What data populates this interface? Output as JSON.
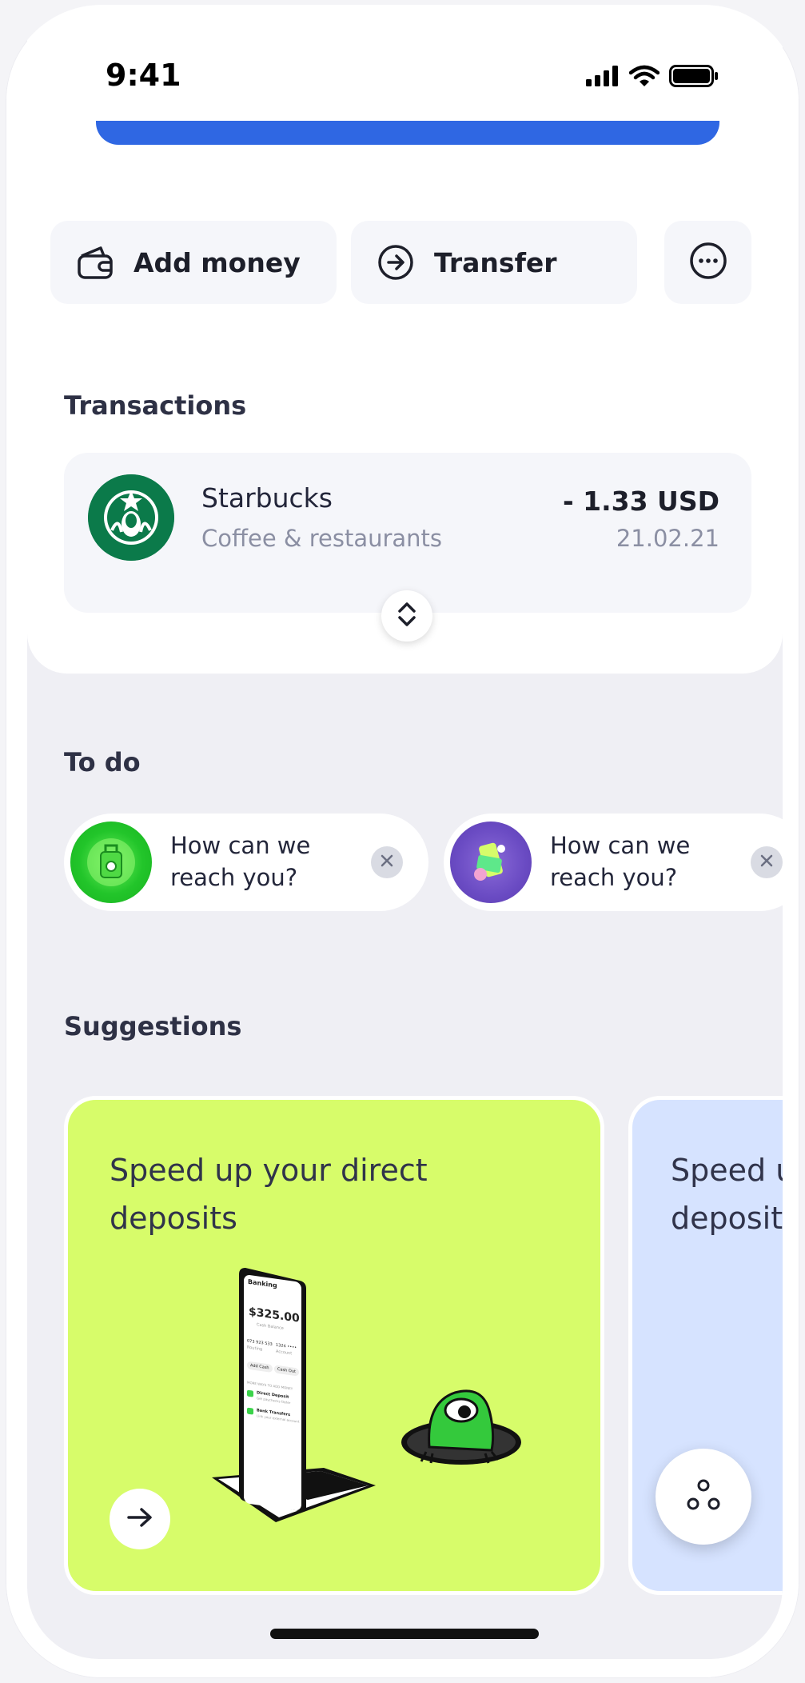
{
  "status_bar": {
    "time": "9:41"
  },
  "actions": {
    "add_money": "Add money",
    "transfer": "Transfer"
  },
  "transactions": {
    "title": "Transactions",
    "items": [
      {
        "merchant": "Starbucks",
        "category": "Coffee & restaurants",
        "amount": "- 1.33 USD",
        "date": "21.02.21"
      }
    ]
  },
  "todo": {
    "title": "To do",
    "items": [
      {
        "text": "How can we reach you?"
      },
      {
        "text": "How can we reach you?"
      }
    ]
  },
  "suggestions": {
    "title": "Suggestions",
    "cards": [
      {
        "title": "Speed up your direct deposits",
        "color": "#d7fc6a"
      },
      {
        "title": "Speed up your direct deposits",
        "color": "#d6e3ff"
      }
    ]
  },
  "phone_mock": {
    "header": "Banking",
    "balance": "$325.00",
    "balance_caption": "Cash Balance",
    "routing": "073 923 533",
    "routing_label": "Routing",
    "account": "1324 ••••",
    "account_label": "Account",
    "add_cash": "Add Cash",
    "cash_out": "Cash Out",
    "more_ways": "MORE WAYS TO ADD MONEY",
    "row1_title": "Direct Deposit",
    "row1_sub": "Get paychecks faster",
    "row2_title": "Bank Transfers",
    "row2_sub": "Link your external account"
  },
  "colors": {
    "accent_blue": "#2f67e3",
    "starbucks_green": "#0b7a4a",
    "lime": "#d7fc6a"
  }
}
